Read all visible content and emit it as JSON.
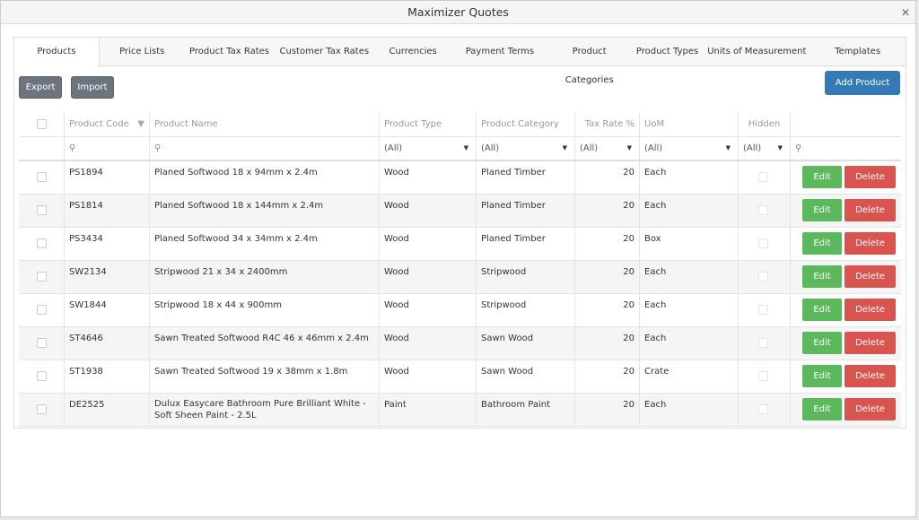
{
  "window": {
    "title": "Maximizer Quotes"
  },
  "tabs": [
    "Products",
    "Price Lists",
    "Product Tax Rates",
    "Customer Tax Rates",
    "Currencies",
    "Payment Terms",
    "Product Categories",
    "Product Types",
    "Units of Measurement",
    "Templates"
  ],
  "toolbar": {
    "export": "Export",
    "import": "Import",
    "add": "Add Product"
  },
  "columns": [
    "Product Code",
    "Product Name",
    "Product Type",
    "Product Category",
    "Tax Rate %",
    "UoM",
    "Hidden"
  ],
  "filters": {
    "all": "(All)"
  },
  "actions": {
    "edit": "Edit",
    "delete": "Delete"
  },
  "rows": [
    {
      "code": "PS1894",
      "name": "Planed Softwood 18 x 94mm x 2.4m",
      "type": "Wood",
      "category": "Planed Timber",
      "tax": "20",
      "uom": "Each"
    },
    {
      "code": "PS1814",
      "name": "Planed Softwood 18 x 144mm x 2.4m",
      "type": "Wood",
      "category": "Planed Timber",
      "tax": "20",
      "uom": "Each"
    },
    {
      "code": "PS3434",
      "name": "Planed Softwood 34 x 34mm x 2.4m",
      "type": "Wood",
      "category": "Planed Timber",
      "tax": "20",
      "uom": "Box"
    },
    {
      "code": "SW2134",
      "name": "Stripwood 21 x 34 x 2400mm",
      "type": "Wood",
      "category": "Stripwood",
      "tax": "20",
      "uom": "Each"
    },
    {
      "code": "SW1844",
      "name": "Stripwood 18 x 44 x 900mm",
      "type": "Wood",
      "category": "Stripwood",
      "tax": "20",
      "uom": "Each"
    },
    {
      "code": "ST4646",
      "name": "Sawn Treated Softwood R4C 46 x 46mm x 2.4m",
      "type": "Wood",
      "category": "Sawn Wood",
      "tax": "20",
      "uom": "Each"
    },
    {
      "code": "ST1938",
      "name": "Sawn Treated Softwood 19 x 38mm x 1.8m",
      "type": "Wood",
      "category": "Sawn Wood",
      "tax": "20",
      "uom": "Crate"
    },
    {
      "code": "DE2525",
      "name": "Dulux Easycare Bathroom Pure Brilliant White - Soft Sheen Paint - 2.5L",
      "type": "Paint",
      "category": "Bathroom Paint",
      "tax": "20",
      "uom": "Each"
    }
  ],
  "colors": {
    "add": "#337ab7",
    "edit": "#5cb85c",
    "delete": "#d9534f",
    "secondary": "#6c757d"
  }
}
